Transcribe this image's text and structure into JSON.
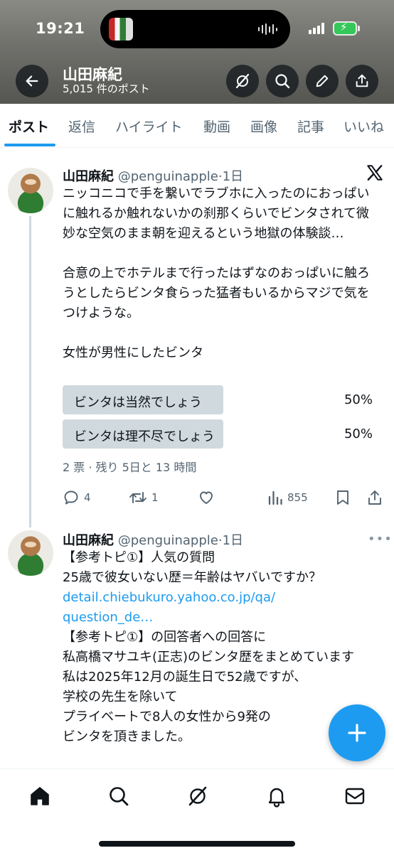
{
  "status_bar": {
    "time": "19:21"
  },
  "header": {
    "name": "山田麻紀",
    "post_count": "5,015 件のポスト",
    "buttons": [
      "back-arrow-icon",
      "grok-icon",
      "search-icon",
      "edit-icon",
      "share-icon"
    ]
  },
  "tabs": [
    {
      "label": "ポスト",
      "active": true
    },
    {
      "label": "返信",
      "active": false
    },
    {
      "label": "ハイライト",
      "active": false
    },
    {
      "label": "動画",
      "active": false
    },
    {
      "label": "画像",
      "active": false
    },
    {
      "label": "記事",
      "active": false
    },
    {
      "label": "いいね",
      "active": false
    }
  ],
  "tweets": [
    {
      "name": "山田麻紀",
      "handle": "@penguinapple",
      "separator": "·",
      "time": "1日",
      "text": [
        "ニッコニコで手を繋いでラブホに入ったのにおっぱいに触れるか触れないかの刹那くらいでビンタされて微妙な空気のまま朝を迎えるという地獄の体験談…",
        "",
        "合意の上でホテルまで行ったはずなのおっぱいに触ろうとしたらビンタ食らった猛者もいるからマジで気をつけような。",
        "",
        "女性が男性にしたビンタ"
      ],
      "poll": {
        "options": [
          {
            "label": "ビンタは当然でしょう",
            "percent_label": "50%",
            "percent": 50
          },
          {
            "label": "ビンタは理不尽でしょう",
            "percent_label": "50%",
            "percent": 50
          }
        ],
        "meta": "2 票 · 残り 5日と 13 時間"
      },
      "stats": {
        "replies": "4",
        "reposts": "1",
        "likes": "",
        "views": "855"
      }
    },
    {
      "name": "山田麻紀",
      "handle": "@penguinapple",
      "separator": "·",
      "time": "1日",
      "text_line1": "【参考トピ①】人気の質問",
      "text_line2": "25歳で彼女いない歴＝年齢はヤバいですか？",
      "link_line1": "detail.chiebukuro.yahoo.co.jp/qa/",
      "link_line2": "question_de…",
      "text_rest": [
        "【参考トピ①】の回答者への回答に",
        "私高橋マサユキ(正志)のビンタ歴をまとめています",
        "私は2025年12月の誕生日で52歳ですが、",
        "学校の先生を除いて",
        "プライベートで8人の女性から9発の",
        "ビンタを頂きました。"
      ]
    }
  ],
  "bottom_nav": [
    "home-icon",
    "search-icon",
    "grok-icon",
    "notifications-icon",
    "messages-icon"
  ],
  "colors": {
    "accent": "#1d9bf0",
    "text_primary": "#0f1419",
    "text_secondary": "#536471",
    "poll_bar": "#cfd9de"
  }
}
